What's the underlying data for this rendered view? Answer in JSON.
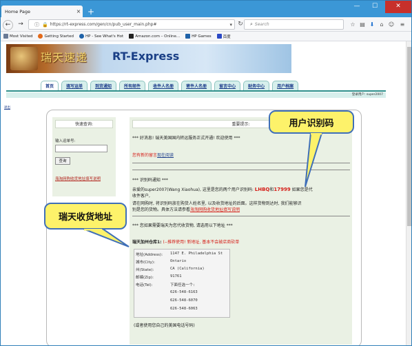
{
  "browser": {
    "tab_title": "Home Page",
    "tab_close": "×",
    "new_tab": "+",
    "url": "https://rt-express.com/gen/cn/pub_user_main.php#",
    "search_placeholder": "Search",
    "win_min": "—",
    "win_max": "☐",
    "win_close": "✕",
    "icons": [
      "lock-icon",
      "reload-icon",
      "star-icon",
      "clipboard-icon",
      "home-icon",
      "download-icon",
      "pocket-icon",
      "smiley-icon",
      "menu-icon"
    ]
  },
  "bookmarks": [
    {
      "label": "Most Visited",
      "color": "#6a7a96"
    },
    {
      "label": "Getting Started",
      "color": "#e36a1b"
    },
    {
      "label": "HP - See What's Hot",
      "color": "#1f62a8"
    },
    {
      "label": "Amazon.com – Online...",
      "color": "#222222"
    },
    {
      "label": "HP Games",
      "color": "#1f62a8"
    },
    {
      "label": "百度",
      "color": "#2b49c5"
    }
  ],
  "site": {
    "logo_cn": "瑞天速递",
    "logo_en": "RT-Express",
    "menu": [
      "首页",
      "填写运单",
      "到货通知",
      "所有邮件",
      "收件人名册",
      "寄件人名册",
      "留言中心",
      "财务中心",
      "用户档案"
    ],
    "login_user": "登录用户: super2007",
    "exit_link": "退出"
  },
  "sidebar": {
    "title": "快速查询:",
    "label": "输入运单号:",
    "input_value": "",
    "button": "查询",
    "link": "海淘网购收货地址填写说明"
  },
  "notice": {
    "title": "重要提示:",
    "line1": "*** 好消息! 瑞天美国国内转运服务正式开通! 欢迎使用 ***",
    "line2a": "您有新的留言",
    "line2b": "现在阅读",
    "line3": "*** 识别码通知 ***",
    "line4": "亲爱的super2007(Wang Xiaohua), 这里是您的两个用户识别码: ",
    "code1": "LHBQ",
    "and": "和",
    "code2": "17999",
    "line4b": " 如果您是代",
    "line5": "收件客户,",
    "line6": "请在网购时, 将识别码放在购货人姓名里, 以及收货地址的后面。这样货物到达时, 我们能够识",
    "line7a": "别是您的货物。具体方法请参看",
    "line7b": "海淘网购收货地址填写说明",
    "line8": "*** 您如果需要瑞天为您代收货物, 请选用以下地址 ***",
    "warehouse": "瑞天加州仓库1:",
    "warehouse_note": "(--推荐使用! 新地址, 基本不会被店商砍单",
    "addr_labels": [
      "地址(Address):",
      "城市(City):",
      "州(State):",
      "邮编(Zip):",
      "电话(Tel):"
    ],
    "addr_values": [
      "1147 E. Philadelphia St",
      "Ontario",
      "CA (California)",
      "91761",
      "下面任选一个:",
      "626-548-6163",
      "626-548-6070",
      "626-548-6063"
    ],
    "phone_note": "(或者使用您自己的美国电话号码)"
  },
  "callouts": {
    "top_right": "用户识别码",
    "left": "瑞天收货地址"
  }
}
